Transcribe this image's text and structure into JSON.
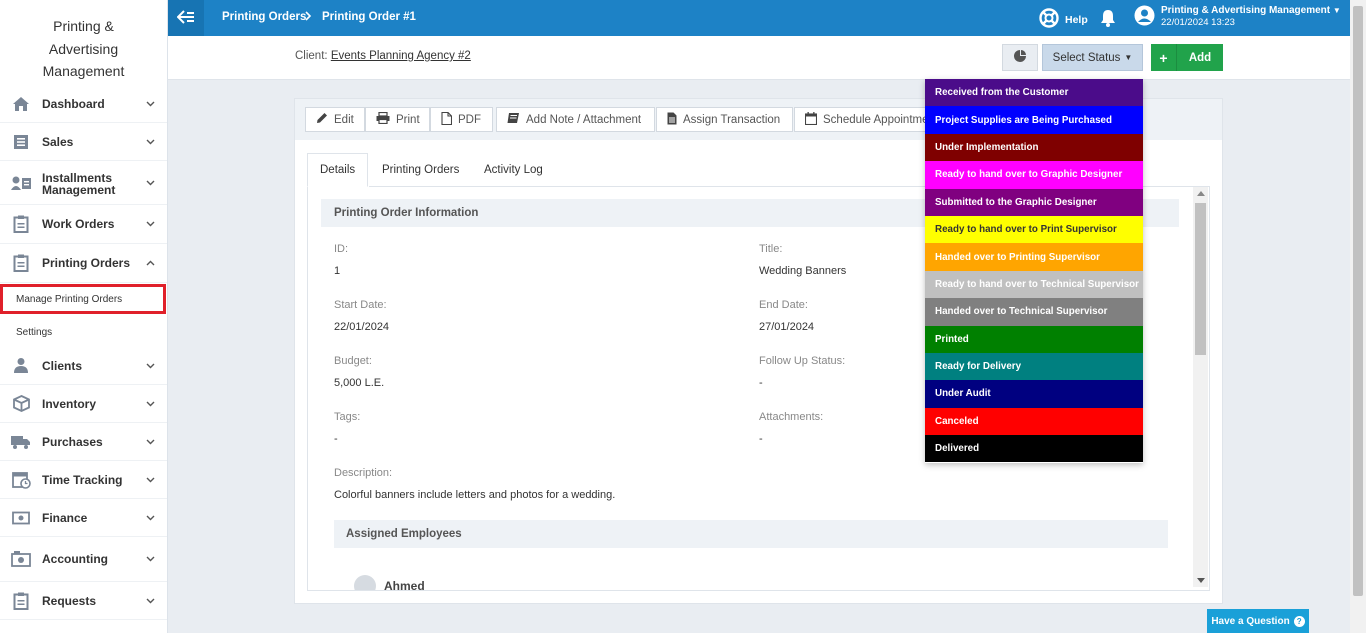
{
  "brand": {
    "line1": "Printing &",
    "line2": "Advertising",
    "line3": "Management"
  },
  "sidebar": {
    "items": [
      {
        "label": "Dashboard",
        "icon": "home-icon"
      },
      {
        "label": "Sales",
        "icon": "sales-icon"
      },
      {
        "label": "Installments",
        "label2": "Management",
        "icon": "installments-icon"
      },
      {
        "label": "Work Orders",
        "icon": "clipboard-icon"
      },
      {
        "label": "Printing Orders",
        "icon": "clipboard-icon"
      },
      {
        "label": "Clients",
        "icon": "user-icon"
      },
      {
        "label": "Inventory",
        "icon": "box-icon"
      },
      {
        "label": "Purchases",
        "icon": "truck-icon"
      },
      {
        "label": "Time Tracking",
        "icon": "calendar-clock-icon"
      },
      {
        "label": "Finance",
        "icon": "money-icon"
      },
      {
        "label": "Accounting",
        "icon": "register-icon"
      },
      {
        "label": "Requests",
        "icon": "list-icon"
      }
    ],
    "sub": {
      "manage": "Manage Printing Orders",
      "settings": "Settings"
    }
  },
  "topbar": {
    "crumb1": "Printing Orders",
    "crumb2": "Printing Order #1",
    "help": "Help",
    "user_name": "Printing & Advertising Management",
    "user_date": "22/01/2024 13:23"
  },
  "header": {
    "client_label": "Client:",
    "client_name": "Events Planning Agency #2",
    "status_btn": "Select Status",
    "add_btn": "Add"
  },
  "toolbar": {
    "edit": "Edit",
    "print": "Print",
    "pdf": "PDF",
    "note": "Add Note / Attachment",
    "assign": "Assign Transaction",
    "schedule": "Schedule Appointme"
  },
  "tabs": {
    "details": "Details",
    "orders": "Printing Orders",
    "log": "Activity Log"
  },
  "details": {
    "section": "Printing Order Information",
    "id_label": "ID:",
    "id": "1",
    "title_label": "Title:",
    "title": "Wedding Banners",
    "start_label": "Start Date:",
    "start": "22/01/2024",
    "end_label": "End Date:",
    "end": "27/01/2024",
    "budget_label": "Budget:",
    "budget": "5,000 L.E.",
    "follow_label": "Follow Up Status:",
    "follow": "-",
    "tags_label": "Tags:",
    "tags": "-",
    "attach_label": "Attachments:",
    "attach": "-",
    "desc_label": "Description:",
    "desc": "Colorful banners include letters and photos for a wedding.",
    "assigned": "Assigned Employees",
    "employee": "Ahmed"
  },
  "status_options": [
    {
      "label": "Received from the Customer",
      "color": "#4b0c8a"
    },
    {
      "label": "Project Supplies are Being Purchased",
      "color": "#0000ff"
    },
    {
      "label": "Under Implementation",
      "color": "#7f0000"
    },
    {
      "label": "Ready to hand over to Graphic Designer",
      "color": "#ff00ff"
    },
    {
      "label": "Submitted to the Graphic Designer",
      "color": "#800080"
    },
    {
      "label": "Ready to hand over to Print Supervisor",
      "color": "#ffff00",
      "text": "#333333"
    },
    {
      "label": "Handed over to Printing Supervisor",
      "color": "#ffa500"
    },
    {
      "label": "Ready to hand over to Technical Supervisor",
      "color": "#c0c0c0"
    },
    {
      "label": "Handed over to Technical Supervisor",
      "color": "#808080"
    },
    {
      "label": "Printed",
      "color": "#008000"
    },
    {
      "label": "Ready for Delivery",
      "color": "#008080"
    },
    {
      "label": "Under Audit",
      "color": "#000080"
    },
    {
      "label": "Canceled",
      "color": "#ff0000"
    },
    {
      "label": "Delivered",
      "color": "#000000"
    }
  ],
  "question": "Have a Question"
}
